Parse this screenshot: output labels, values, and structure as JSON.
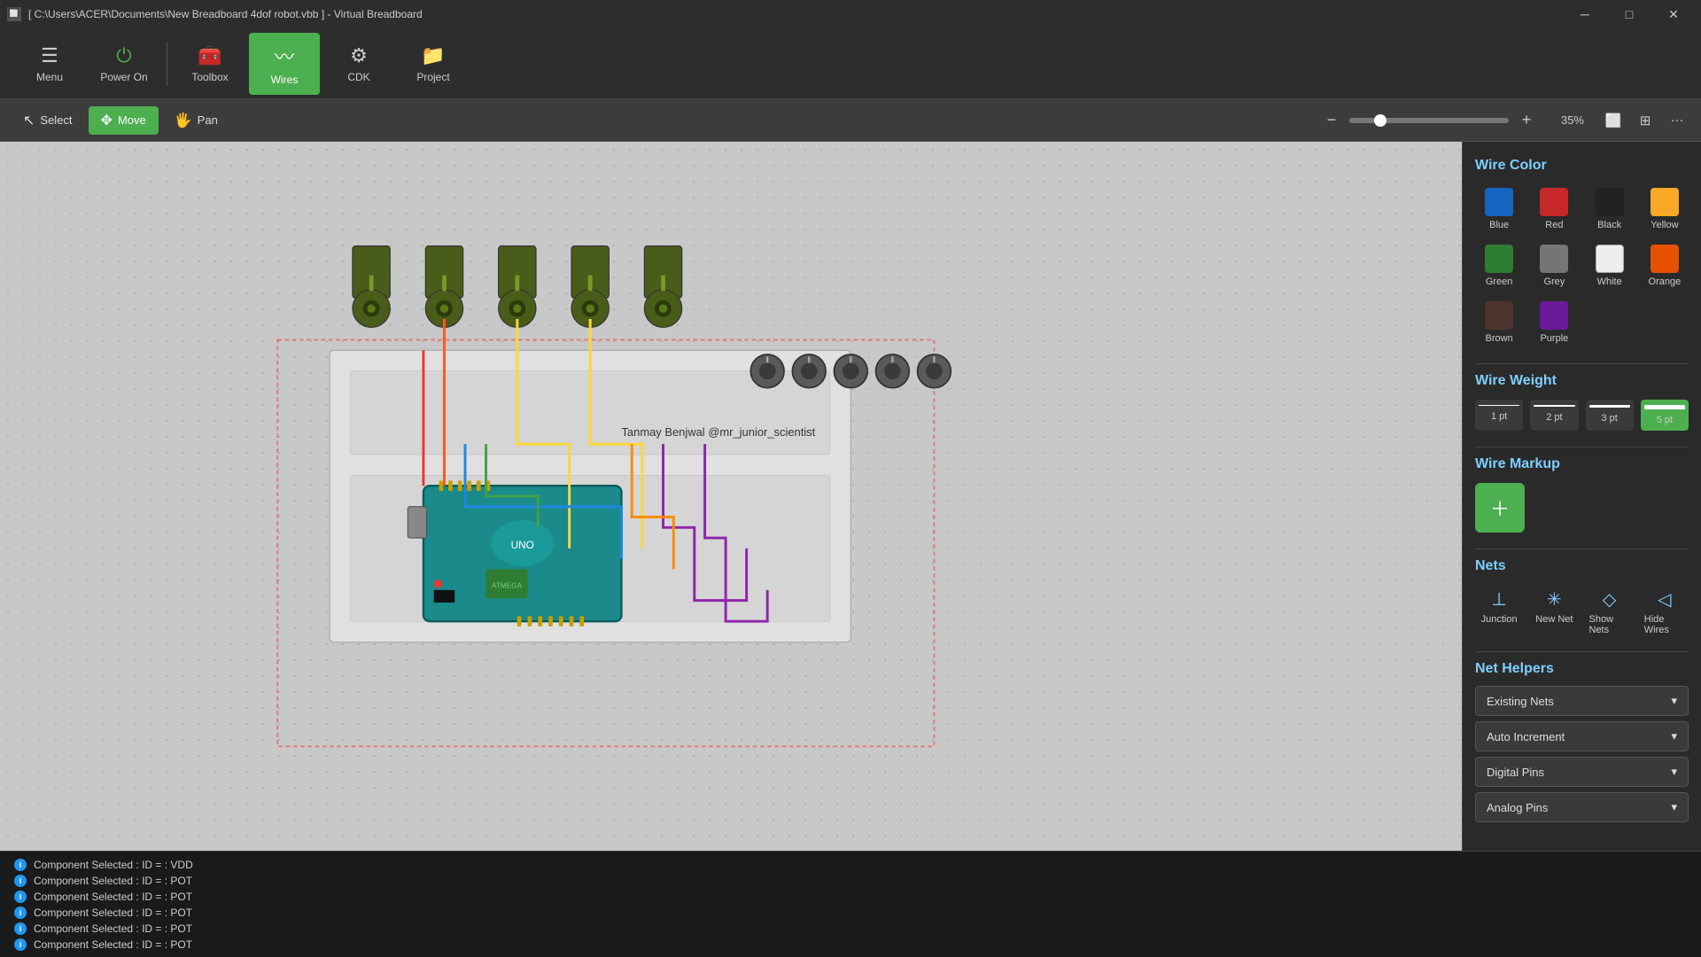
{
  "titlebar": {
    "icon": "🔲",
    "title": "[ C:\\Users\\ACER\\Documents\\New Breadboard 4dof robot.vbb ] - Virtual Breadboard",
    "minimize": "─",
    "maximize": "□",
    "close": "✕"
  },
  "toolbar": {
    "items": [
      {
        "id": "menu",
        "icon": "☰",
        "label": "Menu",
        "active": false
      },
      {
        "id": "power-on",
        "icon": "⏻",
        "label": "Power On",
        "active": false
      },
      {
        "id": "toolbox",
        "icon": "🧰",
        "label": "Toolbox",
        "active": false
      },
      {
        "id": "wires",
        "icon": "〰",
        "label": "Wires",
        "active": true
      },
      {
        "id": "cdk",
        "icon": "⚙",
        "label": "CDK",
        "active": false
      },
      {
        "id": "project",
        "icon": "📁",
        "label": "Project",
        "active": false
      }
    ]
  },
  "actionbar": {
    "select_label": "Select",
    "move_label": "Move",
    "pan_label": "Pan",
    "zoom_value": 35,
    "zoom_display": "35%"
  },
  "right_panel": {
    "wire_color_title": "Wire Color",
    "colors": [
      {
        "id": "blue",
        "label": "Blue",
        "hex": "#1565c0"
      },
      {
        "id": "red",
        "label": "Red",
        "hex": "#c62828"
      },
      {
        "id": "black",
        "label": "Black",
        "hex": "#212121"
      },
      {
        "id": "yellow",
        "label": "Yellow",
        "hex": "#f9a825"
      },
      {
        "id": "green",
        "label": "Green",
        "hex": "#2e7d32"
      },
      {
        "id": "grey",
        "label": "Grey",
        "hex": "#757575"
      },
      {
        "id": "white",
        "label": "White",
        "hex": "#eeeeee"
      },
      {
        "id": "orange",
        "label": "Orange",
        "hex": "#e65100"
      },
      {
        "id": "brown",
        "label": "Brown",
        "hex": "#4e342e"
      },
      {
        "id": "purple",
        "label": "Purple",
        "hex": "#6a1b9a"
      }
    ],
    "wire_weight_title": "Wire Weight",
    "weights": [
      {
        "id": "1pt",
        "label": "1 pt",
        "height": 1,
        "selected": false
      },
      {
        "id": "2pt",
        "label": "2 pt",
        "height": 2,
        "selected": false
      },
      {
        "id": "3pt",
        "label": "3 pt",
        "height": 3,
        "selected": false
      },
      {
        "id": "5pt",
        "label": "5 pt",
        "height": 5,
        "selected": true
      }
    ],
    "wire_markup_title": "Wire Markup",
    "nets_title": "Nets",
    "nets_items": [
      {
        "id": "junction",
        "icon": "⊥",
        "label": "Junction"
      },
      {
        "id": "new-net",
        "icon": "✳",
        "label": "New Net"
      },
      {
        "id": "show-nets",
        "icon": "◇",
        "label": "Show Nets"
      },
      {
        "id": "hide-wires",
        "icon": "◁",
        "label": "Hide Wires"
      }
    ],
    "net_helpers_title": "Net Helpers",
    "dropdowns": [
      {
        "id": "existing-nets",
        "label": "Existing Nets"
      },
      {
        "id": "auto-increment",
        "label": "Auto Increment"
      },
      {
        "id": "digital-pins",
        "label": "Digital Pins"
      },
      {
        "id": "analog-pins",
        "label": "Analog Pins"
      }
    ]
  },
  "statusbar": {
    "lines": [
      {
        "text": "Component Selected : ID =  : VDD"
      },
      {
        "text": "Component Selected : ID =  : POT"
      },
      {
        "text": "Component Selected : ID =  : POT"
      },
      {
        "text": "Component Selected : ID =  : POT"
      },
      {
        "text": "Component Selected : ID =  : POT"
      },
      {
        "text": "Component Selected : ID =  : POT"
      }
    ]
  },
  "canvas": {
    "attribution": "Tanmay Benjwal @mr_junior_scientist"
  }
}
